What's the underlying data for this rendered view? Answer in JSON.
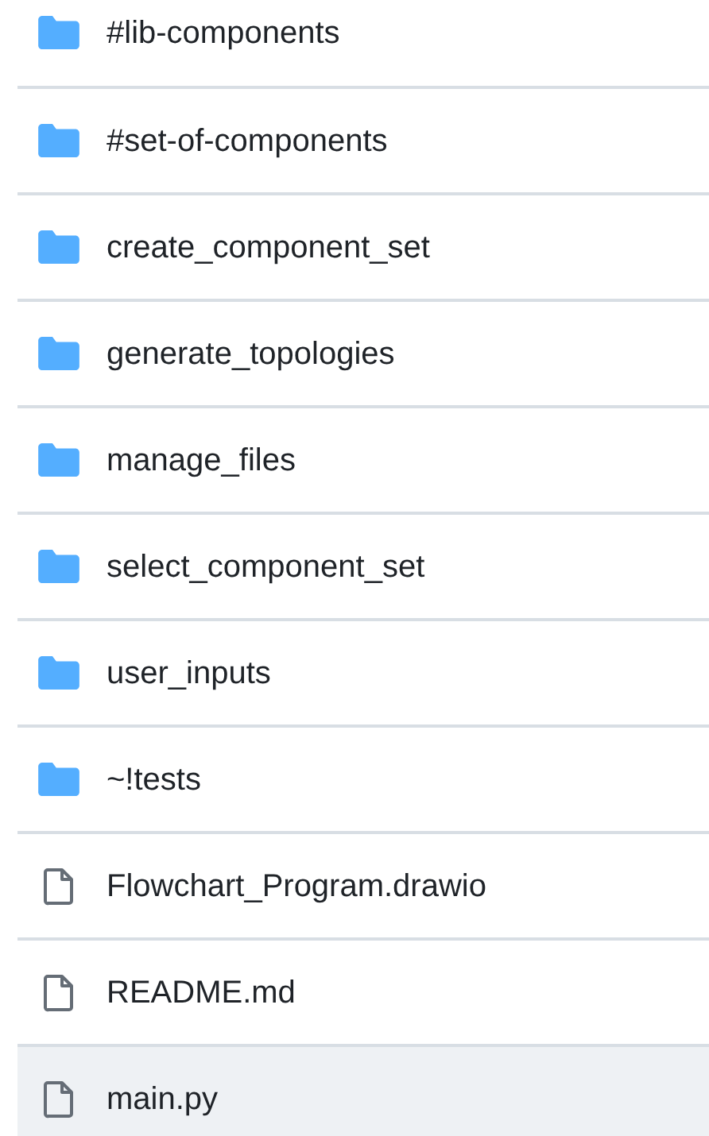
{
  "files": [
    {
      "name": "#lib-components",
      "kind": "folder",
      "highlighted": false
    },
    {
      "name": "#set-of-components",
      "kind": "folder",
      "highlighted": false
    },
    {
      "name": "create_component_set",
      "kind": "folder",
      "highlighted": false
    },
    {
      "name": "generate_topologies",
      "kind": "folder",
      "highlighted": false
    },
    {
      "name": "manage_files",
      "kind": "folder",
      "highlighted": false
    },
    {
      "name": "select_component_set",
      "kind": "folder",
      "highlighted": false
    },
    {
      "name": "user_inputs",
      "kind": "folder",
      "highlighted": false
    },
    {
      "name": "~!tests",
      "kind": "folder",
      "highlighted": false
    },
    {
      "name": "Flowchart_Program.drawio",
      "kind": "file",
      "highlighted": false
    },
    {
      "name": "README.md",
      "kind": "file",
      "highlighted": false
    },
    {
      "name": "main.py",
      "kind": "file",
      "highlighted": true
    }
  ]
}
